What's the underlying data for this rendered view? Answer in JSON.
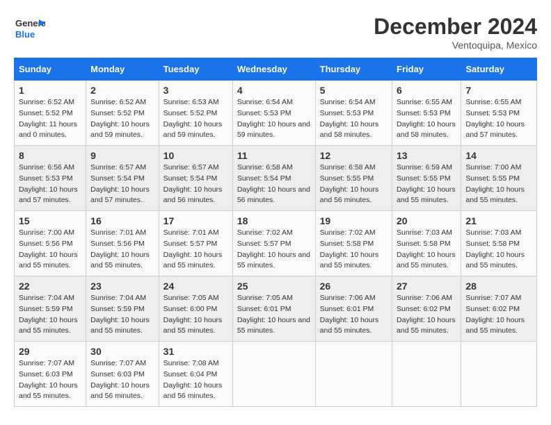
{
  "header": {
    "logo_line1": "General",
    "logo_line2": "Blue",
    "title": "December 2024",
    "location": "Ventoquipa, Mexico"
  },
  "days_of_week": [
    "Sunday",
    "Monday",
    "Tuesday",
    "Wednesday",
    "Thursday",
    "Friday",
    "Saturday"
  ],
  "weeks": [
    [
      {
        "day": "1",
        "sunrise": "6:52 AM",
        "sunset": "5:52 PM",
        "daylight": "11 hours and 0 minutes."
      },
      {
        "day": "2",
        "sunrise": "6:52 AM",
        "sunset": "5:52 PM",
        "daylight": "10 hours and 59 minutes."
      },
      {
        "day": "3",
        "sunrise": "6:53 AM",
        "sunset": "5:52 PM",
        "daylight": "10 hours and 59 minutes."
      },
      {
        "day": "4",
        "sunrise": "6:54 AM",
        "sunset": "5:53 PM",
        "daylight": "10 hours and 59 minutes."
      },
      {
        "day": "5",
        "sunrise": "6:54 AM",
        "sunset": "5:53 PM",
        "daylight": "10 hours and 58 minutes."
      },
      {
        "day": "6",
        "sunrise": "6:55 AM",
        "sunset": "5:53 PM",
        "daylight": "10 hours and 58 minutes."
      },
      {
        "day": "7",
        "sunrise": "6:55 AM",
        "sunset": "5:53 PM",
        "daylight": "10 hours and 57 minutes."
      }
    ],
    [
      {
        "day": "8",
        "sunrise": "6:56 AM",
        "sunset": "5:53 PM",
        "daylight": "10 hours and 57 minutes."
      },
      {
        "day": "9",
        "sunrise": "6:57 AM",
        "sunset": "5:54 PM",
        "daylight": "10 hours and 57 minutes."
      },
      {
        "day": "10",
        "sunrise": "6:57 AM",
        "sunset": "5:54 PM",
        "daylight": "10 hours and 56 minutes."
      },
      {
        "day": "11",
        "sunrise": "6:58 AM",
        "sunset": "5:54 PM",
        "daylight": "10 hours and 56 minutes."
      },
      {
        "day": "12",
        "sunrise": "6:58 AM",
        "sunset": "5:55 PM",
        "daylight": "10 hours and 56 minutes."
      },
      {
        "day": "13",
        "sunrise": "6:59 AM",
        "sunset": "5:55 PM",
        "daylight": "10 hours and 55 minutes."
      },
      {
        "day": "14",
        "sunrise": "7:00 AM",
        "sunset": "5:55 PM",
        "daylight": "10 hours and 55 minutes."
      }
    ],
    [
      {
        "day": "15",
        "sunrise": "7:00 AM",
        "sunset": "5:56 PM",
        "daylight": "10 hours and 55 minutes."
      },
      {
        "day": "16",
        "sunrise": "7:01 AM",
        "sunset": "5:56 PM",
        "daylight": "10 hours and 55 minutes."
      },
      {
        "day": "17",
        "sunrise": "7:01 AM",
        "sunset": "5:57 PM",
        "daylight": "10 hours and 55 minutes."
      },
      {
        "day": "18",
        "sunrise": "7:02 AM",
        "sunset": "5:57 PM",
        "daylight": "10 hours and 55 minutes."
      },
      {
        "day": "19",
        "sunrise": "7:02 AM",
        "sunset": "5:58 PM",
        "daylight": "10 hours and 55 minutes."
      },
      {
        "day": "20",
        "sunrise": "7:03 AM",
        "sunset": "5:58 PM",
        "daylight": "10 hours and 55 minutes."
      },
      {
        "day": "21",
        "sunrise": "7:03 AM",
        "sunset": "5:58 PM",
        "daylight": "10 hours and 55 minutes."
      }
    ],
    [
      {
        "day": "22",
        "sunrise": "7:04 AM",
        "sunset": "5:59 PM",
        "daylight": "10 hours and 55 minutes."
      },
      {
        "day": "23",
        "sunrise": "7:04 AM",
        "sunset": "5:59 PM",
        "daylight": "10 hours and 55 minutes."
      },
      {
        "day": "24",
        "sunrise": "7:05 AM",
        "sunset": "6:00 PM",
        "daylight": "10 hours and 55 minutes."
      },
      {
        "day": "25",
        "sunrise": "7:05 AM",
        "sunset": "6:01 PM",
        "daylight": "10 hours and 55 minutes."
      },
      {
        "day": "26",
        "sunrise": "7:06 AM",
        "sunset": "6:01 PM",
        "daylight": "10 hours and 55 minutes."
      },
      {
        "day": "27",
        "sunrise": "7:06 AM",
        "sunset": "6:02 PM",
        "daylight": "10 hours and 55 minutes."
      },
      {
        "day": "28",
        "sunrise": "7:07 AM",
        "sunset": "6:02 PM",
        "daylight": "10 hours and 55 minutes."
      }
    ],
    [
      {
        "day": "29",
        "sunrise": "7:07 AM",
        "sunset": "6:03 PM",
        "daylight": "10 hours and 55 minutes."
      },
      {
        "day": "30",
        "sunrise": "7:07 AM",
        "sunset": "6:03 PM",
        "daylight": "10 hours and 56 minutes."
      },
      {
        "day": "31",
        "sunrise": "7:08 AM",
        "sunset": "6:04 PM",
        "daylight": "10 hours and 56 minutes."
      },
      {
        "day": "",
        "sunrise": "",
        "sunset": "",
        "daylight": ""
      },
      {
        "day": "",
        "sunrise": "",
        "sunset": "",
        "daylight": ""
      },
      {
        "day": "",
        "sunrise": "",
        "sunset": "",
        "daylight": ""
      },
      {
        "day": "",
        "sunrise": "",
        "sunset": "",
        "daylight": ""
      }
    ]
  ]
}
